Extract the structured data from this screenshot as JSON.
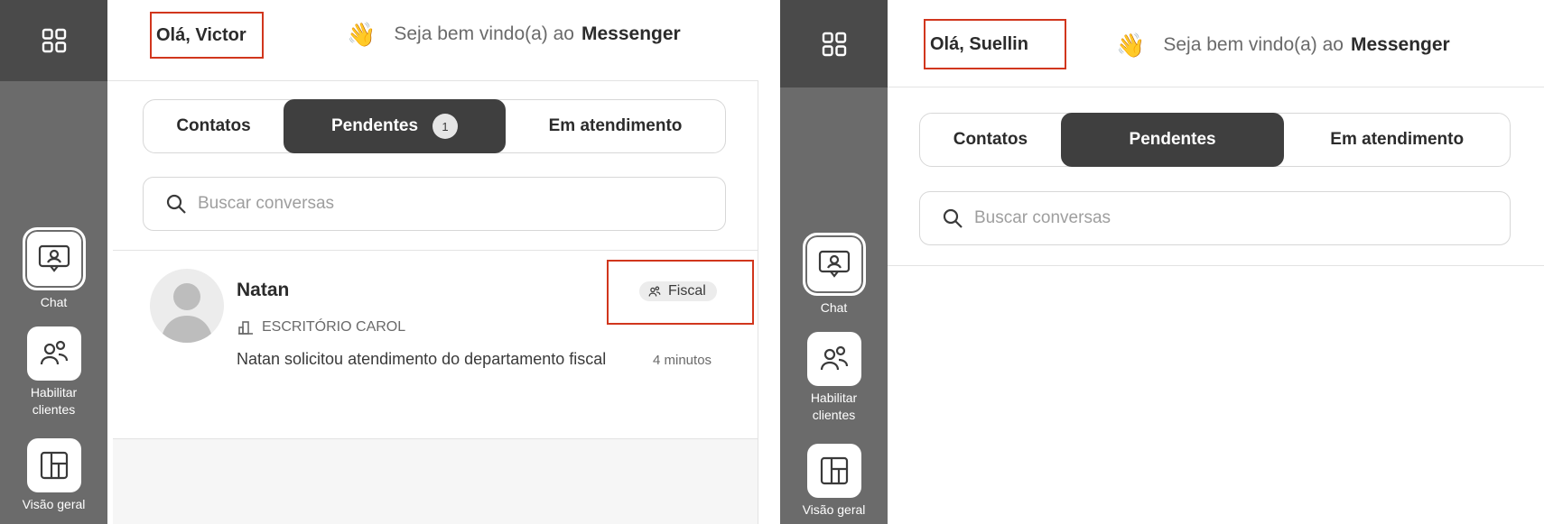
{
  "left": {
    "greeting": "Olá, Victor",
    "welcome": {
      "text": "Seja bem vindo(a) ao",
      "brand": "Messenger"
    },
    "tabs": [
      {
        "label": "Contatos"
      },
      {
        "label": "Pendentes",
        "badge": "1"
      },
      {
        "label": "Em atendimento"
      }
    ],
    "search": {
      "placeholder": "Buscar conversas"
    },
    "conversation": {
      "name": "Natan",
      "company": "ESCRITÓRIO CAROL",
      "tag": "Fiscal",
      "message": "Natan solicitou atendimento do departamento fiscal",
      "time": "4 minutos"
    },
    "nav": [
      {
        "label": "Chat",
        "icon": "chat-user-icon"
      },
      {
        "label": "Habilitar clientes",
        "icon": "users-icon"
      },
      {
        "label": "Visão geral",
        "icon": "dashboard-icon"
      }
    ]
  },
  "right": {
    "greeting": "Olá, Suellin",
    "welcome": {
      "text": "Seja bem vindo(a) ao",
      "brand": "Messenger"
    },
    "tabs": [
      {
        "label": "Contatos"
      },
      {
        "label": "Pendentes"
      },
      {
        "label": "Em atendimento"
      }
    ],
    "search": {
      "placeholder": "Buscar conversas"
    },
    "nav": [
      {
        "label": "Chat",
        "icon": "chat-user-icon"
      },
      {
        "label": "Habilitar clientes",
        "icon": "users-icon"
      },
      {
        "label": "Visão geral",
        "icon": "dashboard-icon"
      }
    ]
  },
  "colors": {
    "highlight": "#d1361d",
    "sidebar": "#6b6b6b",
    "sidebar_top": "#4a4a4a",
    "active_tab": "#3f3f3f"
  },
  "wave_emoji": "👋"
}
